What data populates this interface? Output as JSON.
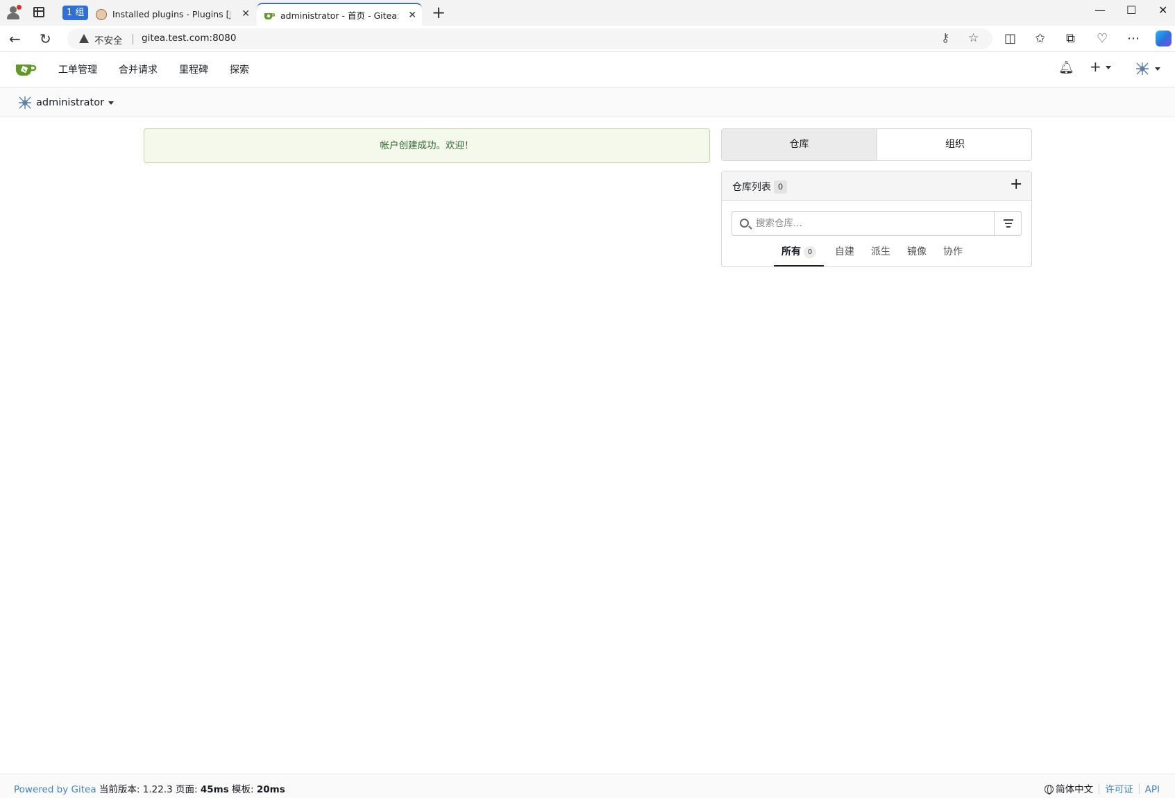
{
  "browser": {
    "tab_group_label": "1 组",
    "tabs": [
      {
        "title": "Installed plugins - Plugins [Jenkins]",
        "close": "✕"
      },
      {
        "title": "administrator - 首页 - Gitea: Git with a cup of tea",
        "close": "✕"
      }
    ],
    "new_tab": "+",
    "security_label": "不安全",
    "url": "gitea.test.com:8080"
  },
  "navbar": {
    "items": [
      "工单管理",
      "合并请求",
      "里程碑",
      "探索"
    ]
  },
  "context": {
    "user": "administrator"
  },
  "flash": {
    "message": "帐户创建成功。欢迎！"
  },
  "switcher": {
    "repos": "仓库",
    "orgs": "组织"
  },
  "repo_panel": {
    "title": "仓库列表",
    "count": "0",
    "search_placeholder": "搜索仓库...",
    "tabs": [
      {
        "label": "所有",
        "count": "0",
        "active": true
      },
      {
        "label": "自建"
      },
      {
        "label": "派生"
      },
      {
        "label": "镜像"
      },
      {
        "label": "协作"
      }
    ]
  },
  "footer": {
    "powered_by": "Powered by Gitea",
    "version_text": "当前版本: 1.22.3 页面:",
    "page_time": "45ms",
    "template_label": "模板:",
    "template_time": "20ms",
    "language": "简体中文",
    "license": "许可证",
    "api": "API"
  },
  "colors": {
    "accent": "#609926",
    "flash_bg": "#f5f9ec",
    "flash_text": "#2c662d",
    "link": "#4183c4"
  }
}
